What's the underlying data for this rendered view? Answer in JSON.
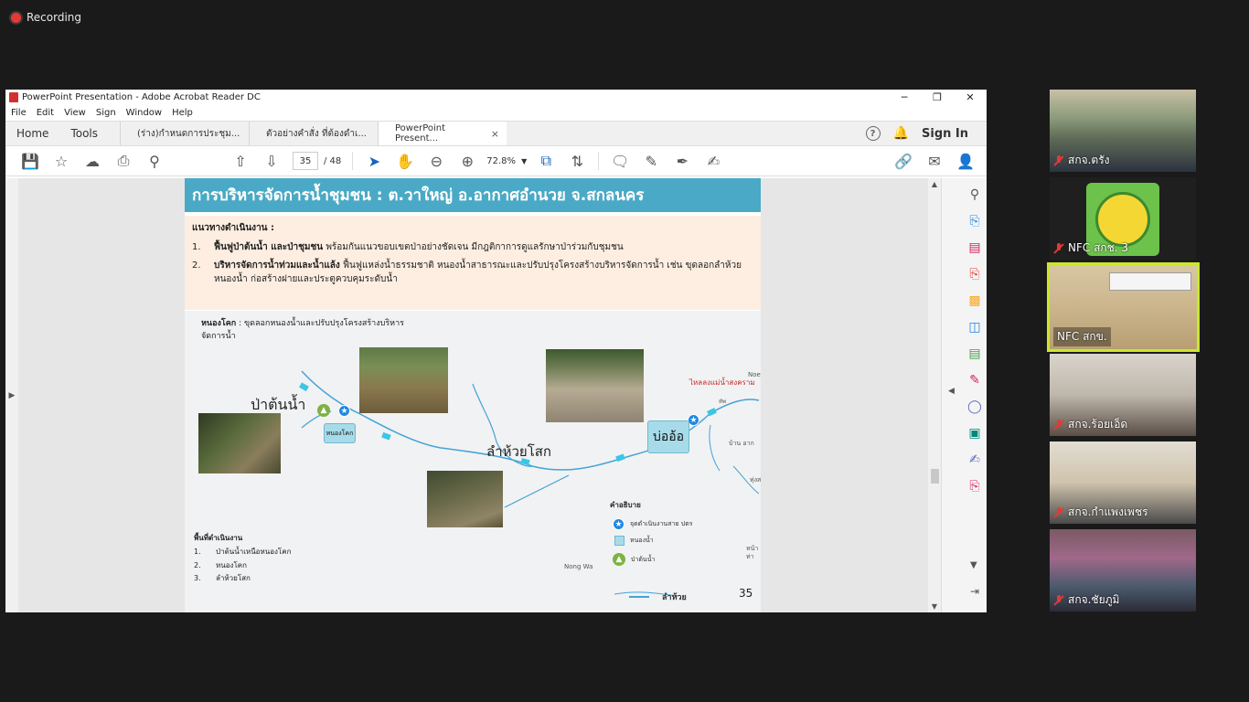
{
  "recording": {
    "label": "Recording"
  },
  "window": {
    "title": "PowerPoint Presentation - Adobe Acrobat Reader DC",
    "controls": {
      "minimize": "─",
      "maximize": "❐",
      "close": "✕"
    }
  },
  "menu": [
    "File",
    "Edit",
    "View",
    "Sign",
    "Window",
    "Help"
  ],
  "tabs": {
    "home": "Home",
    "tools": "Tools",
    "docs": [
      {
        "label": "(ร่าง)กำหนดการประชุม..."
      },
      {
        "label": "ตัวอย่างคำสั่ง ที่ต้องดำเ..."
      },
      {
        "label": "PowerPoint Present...",
        "close": "×"
      }
    ],
    "help_icon": "?",
    "sign_in": "Sign In"
  },
  "toolbar": {
    "page_current": "35",
    "page_total": "/ 48",
    "zoom": "72.8%"
  },
  "slide": {
    "title": "การบริหารจัดการน้ำชุมชน : ต.วาใหญ่ อ.อากาศอำนวย จ.สกลนคร",
    "guidelines_heading": "แนวทางดำเนินงาน :",
    "items": [
      {
        "num": "1.",
        "bold": "ฟื้นฟูป่าต้นน้ำ และป่าชุมชน",
        "text": " พร้อมกันแนวขอบเขตป่าอย่างชัดเจน มีกฎติกาการดูแลรักษาป่าร่วมกับชุมชน"
      },
      {
        "num": "2.",
        "bold": "บริหารจัดการน้ำท่วมและน้ำแล้ง",
        "text": "  ฟื้นฟูแหล่งน้ำธรรมชาติ หนองน้ำสาธารณะและปรับปรุงโครงสร้างบริหารจัดการน้ำ เช่น ขุดลอกลำห้วย หนองน้ำ ก่อสร้างฝายและประตูควบคุมระดับน้ำ"
      }
    ],
    "map": {
      "note_bold": "หนองโคก",
      "note_text": " : ขุดลอกหนองน้ำและปรับปรุงโครงสร้างบริหาร",
      "note_text2": "จัดการน้ำ",
      "label_forest": "ป่าต้นน้ำ",
      "label_nongkhok": "หนองโคก",
      "label_stream": "ลำห้วยโสก",
      "label_bo_o": "บ่ออ้อ",
      "label_outflow": "ไหลลงแม่น้ำสงคราม",
      "town_nong_wa": "Nong Wa",
      "map_edge_noe": "Noe",
      "map_edge_tha": "ท่า",
      "map_edge_thung": "ทุ่งส",
      "map_edge_ban_ha": "บ้าน อาก",
      "map_edge_tha2": "หน้า",
      "map_edge_thap": "ทัพ",
      "area_heading": "พื้นที่ดำเนินงาน",
      "areas": [
        {
          "num": "1.",
          "text": "ป่าต้นน้ำเหนือหนองโคก"
        },
        {
          "num": "2.",
          "text": "หนองโคก"
        },
        {
          "num": "3.",
          "text": "ลำห้วยโสก"
        }
      ],
      "legend_heading": "คำอธิบาย",
      "legend": [
        {
          "icon": "star-marker-icon",
          "text": "จุดดำเนินงานสาย ปตร"
        },
        {
          "icon": "pond-square-icon",
          "text": "หนองน้ำ"
        },
        {
          "icon": "tree-marker-icon",
          "text": "ป่าต้นน้ำ"
        },
        {
          "icon": "stream-line-icon",
          "text": "ลำห้วย"
        }
      ],
      "page_number": "35"
    }
  },
  "participants": [
    {
      "name": "สกจ.ตรัง",
      "muted": true
    },
    {
      "name": "NFC สกช. 3",
      "muted": true
    },
    {
      "name": "NFC สกข.",
      "muted": false,
      "active": true
    },
    {
      "name": "สกจ.ร้อยเอ็ด",
      "muted": true
    },
    {
      "name": "สกจ.กำแพงเพชร",
      "muted": true
    },
    {
      "name": "สกจ.ชัยภูมิ",
      "muted": true
    }
  ],
  "colors": {
    "slide_title_bg": "#4aa9c6",
    "slide_box_bg": "#fdeee1",
    "active_speaker_border": "#c9e72b",
    "recording_dot": "#e53935"
  }
}
